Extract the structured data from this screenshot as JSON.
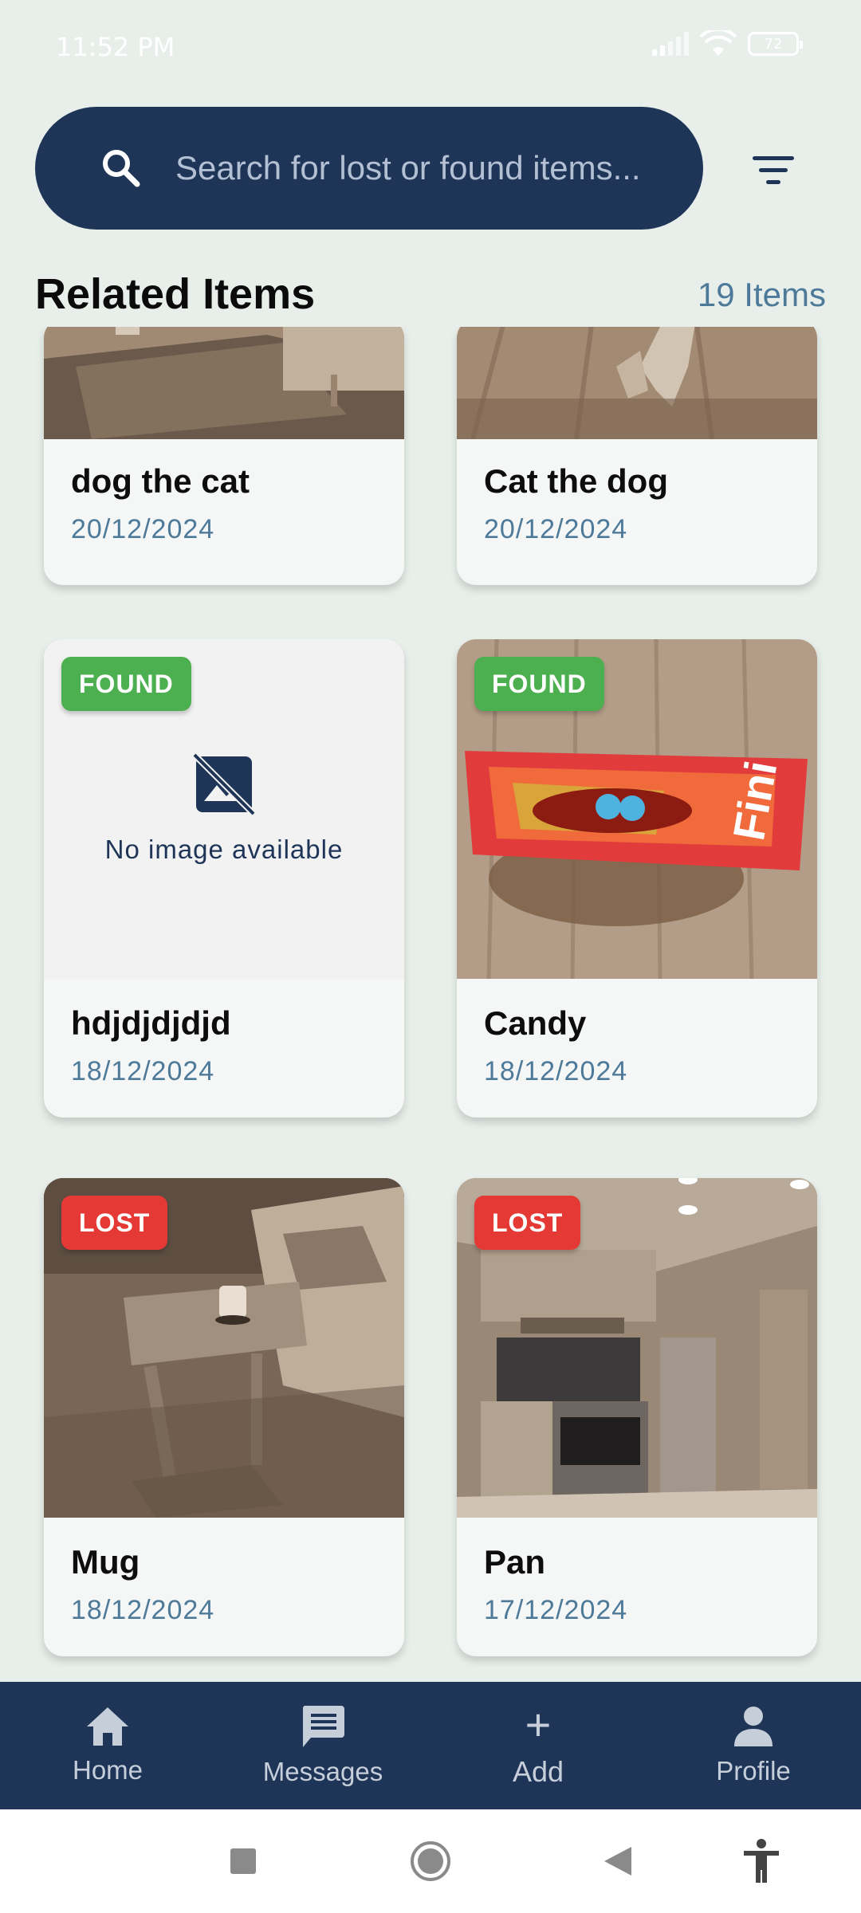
{
  "status_bar": {
    "time": "11:52 PM",
    "battery": "72"
  },
  "search": {
    "placeholder": "Search for lost or found items..."
  },
  "section": {
    "title": "Related Items",
    "count": "19 Items"
  },
  "cards": [
    {
      "title": "dog the cat",
      "date": "20/12/2024",
      "badge": "",
      "image": "living-room-photo"
    },
    {
      "title": "Cat the dog",
      "date": "20/12/2024",
      "badge": "",
      "image": "cat-floor-photo"
    },
    {
      "title": "hdjdjdjdjd",
      "date": "18/12/2024",
      "badge": "FOUND",
      "image": "",
      "no_image_text": "No image available"
    },
    {
      "title": "Candy",
      "date": "18/12/2024",
      "badge": "FOUND",
      "image": "candy-photo"
    },
    {
      "title": "Mug",
      "date": "18/12/2024",
      "badge": "LOST",
      "image": "living-room-mug-photo"
    },
    {
      "title": "Pan",
      "date": "17/12/2024",
      "badge": "LOST",
      "image": "kitchen-photo"
    }
  ],
  "nav": {
    "home": "Home",
    "messages": "Messages",
    "add": "Add",
    "profile": "Profile"
  },
  "colors": {
    "primary": "#1e3558",
    "found": "#4caf50",
    "lost": "#e53935",
    "accent_text": "#4e7a9a",
    "background": "#e8efea"
  }
}
